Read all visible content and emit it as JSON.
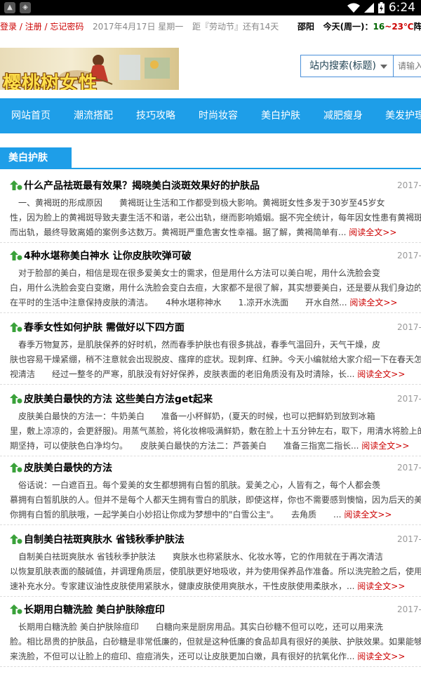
{
  "status_bar": {
    "time": "6:24"
  },
  "topline": {
    "login": "登录",
    "sep1": " / ",
    "register": "注册",
    "sep2": " / ",
    "forgot": "忘记密码",
    "date": "2017年4月17日 星期一",
    "countdown": "距『劳动节』还有14天",
    "city": "邵阳",
    "day_label": "今天(周一)：",
    "temp_low": "16",
    "temp_sep": "~",
    "temp_high": "23℃",
    "condition": "阵雨"
  },
  "logo": {
    "text": "樱桃树女性"
  },
  "search": {
    "scope": "站内搜索(标题)",
    "placeholder": "请输入"
  },
  "nav": {
    "items": [
      "网站首页",
      "潮流搭配",
      "技巧攻略",
      "时尚妆容",
      "美白护肤",
      "减肥瘦身",
      "美发护理"
    ]
  },
  "section": {
    "title": "美白护肤"
  },
  "read_more": "阅读全文>>",
  "articles": [
    {
      "title": "什么产品祛斑最有效果？揭晓美白淡斑效果好的护肤品",
      "date": "2017-",
      "lines": [
        "　一、黄褐斑的形成原因　　黄褐斑让生活和工作都受到极大影响。黄褐斑女性多发于30岁至45岁女",
        "性，因为脸上的黄褐斑导致夫妻生活不和谐，老公出轨，继而影响婚姻。据不完全统计，每年因女性患有黄褐斑",
        "而出轨，最终导致离婚的案例多达数万。黄褐斑严重危害女性幸福。据了解，黄褐简单有..."
      ]
    },
    {
      "title": "4种水堪称美白神水 让你皮肤吹弹可破",
      "date": "2017-",
      "lines": [
        "　对于脸部的美白，相信是现在很多爱美女士的需求，但是用什么方法可以美白呢，用什么洗脸会变",
        "白，用什么洗脸会变白变嫩，用什么洗脸会变白去痘，大家都不是很了解，其实想要美白，还是要从我们身边的",
        "在平时的生活中注意保持皮肤的清洁。　　4种水堪称神水　　1.凉开水洗面　　开水自然..."
      ]
    },
    {
      "title": "春季女性如何护肤 需做好以下四方面",
      "date": "2017-",
      "lines": [
        "　春季万物复苏，是肌肤保养的好时机，然而春季护肤也有很多挑战，春季气温回升，天气干燥，皮",
        "肤也容易干燥紧绷，稍不注意就会出现脱皮、瘙痒的症状。现刺痒、红肿。今天小编就给大家介绍一下在春天怎",
        "视清洁　　经过一整冬的严寒，肌肤没有好好保养，皮肤表面的老旧角质没有及时清除，长..."
      ]
    },
    {
      "title": "皮肤美白最快的方法 这些美白方法get起来",
      "date": "2017-",
      "lines": [
        "　皮肤美白最快的方法一：牛奶美白　　准备一小杯鲜奶，(夏天的时候，也可以把鲜奶到放到冰箱",
        "里，敷上凉凉的，会更舒服)。用蒸气蒸脸，将化妆棉吸满鲜奶，敷在脸上十五分钟左右，取下，用清水将脸上的",
        "期坚持，可以使肤色白净均匀。　　皮肤美白最快的方法二：芦荟美白　　准备三指宽二指长..."
      ]
    },
    {
      "title": "皮肤美白最快的方法",
      "date": "2017-",
      "lines": [
        "　俗话说：一白遮百丑。每个爱美的女生都想拥有白皙的肌肤。爱美之心，人皆有之，每个人都会羡",
        "慕拥有白皙肌肤的人。但并不是每个人都天生拥有雪白的肌肤，即使这样，你也不需要感到懊恼，因为后天的美",
        "你拥有白皙的肌肤哦，一起学美白小妙招让你成为梦想中的\"白雪公主\"。　　去角质　　..."
      ]
    },
    {
      "title": "自制美白祛斑爽肤水 省钱秋季护肤法",
      "date": "2017-",
      "lines": [
        "　自制美白祛斑爽肤水 省钱秋季护肤法　　爽肤水也称紧肤水、化妆水等，它的作用就在于再次清洁",
        "以恢复肌肤表面的酸碱值，并调理角质层，使肌肤更好地吸收，并为使用保养品作准备。所以洗完脸之后，使用",
        "速补充水分。专家建议油性皮肤使用紧肤水，健康皮肤使用爽肤水，干性皮肤使用柔肤水，..."
      ]
    },
    {
      "title": "长期用白糖洗脸 美白护肤除痘印",
      "date": "2017-",
      "lines": [
        "　长期用白糖洗脸 美白护肤除痘印　　白糖向来是厨房用品。其实白砂糖不但可以吃，还可以用来洗",
        "脸。相比昂贵的护肤品，白砂糖是非常低廉的，但就是这种低廉的食品却具有很好的美肤、护肤效果。如果能够",
        "来洗脸，不但可以让脸上的痘印、痘痘消失，还可以让皮肤更加白嫩，具有很好的抗氧化作..."
      ]
    }
  ]
}
